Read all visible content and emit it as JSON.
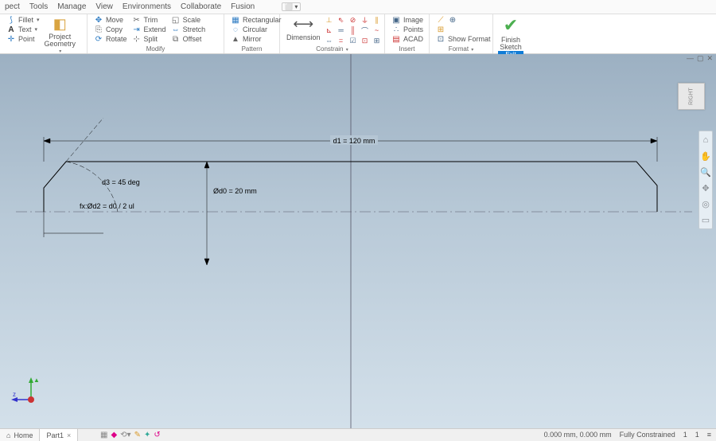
{
  "menu": {
    "items": [
      "pect",
      "Tools",
      "Manage",
      "View",
      "Environments",
      "Collaborate",
      "Fusion"
    ]
  },
  "ribbon": {
    "panels": {
      "create": {
        "fillet": "Fillet",
        "text": "Text",
        "point": "Point",
        "project": "Project\nGeometry"
      },
      "modify": {
        "title": "Modify",
        "move": "Move",
        "copy": "Copy",
        "rotate": "Rotate",
        "trim": "Trim",
        "extend": "Extend",
        "split": "Split",
        "scale": "Scale",
        "stretch": "Stretch",
        "offset": "Offset"
      },
      "pattern": {
        "title": "Pattern",
        "rect": "Rectangular",
        "circ": "Circular",
        "mirror": "Mirror"
      },
      "constrain": {
        "title": "Constrain",
        "dimension": "Dimension"
      },
      "insert": {
        "title": "Insert",
        "image": "Image",
        "points": "Points",
        "acad": "ACAD"
      },
      "format": {
        "title": "Format",
        "show": "Show Format"
      },
      "finish": {
        "label": "Finish\nSketch"
      },
      "exit": {
        "label": "Exit"
      }
    }
  },
  "sketch": {
    "d1": "d1 = 120 mm",
    "d0": "Ød0 = 20 mm",
    "d3": "d3 = 45 deg",
    "d2": "fx:Ød2 = d0 / 2 ul"
  },
  "viewcube": {
    "face": "RIGHT"
  },
  "tabs": {
    "home": "Home",
    "part": "Part1"
  },
  "status": {
    "coords": "0.000 mm, 0.000 mm",
    "state": "Fully Constrained",
    "a": "1",
    "b": "1"
  },
  "window": {
    "min": "—",
    "max": "▢",
    "close": "✕"
  }
}
